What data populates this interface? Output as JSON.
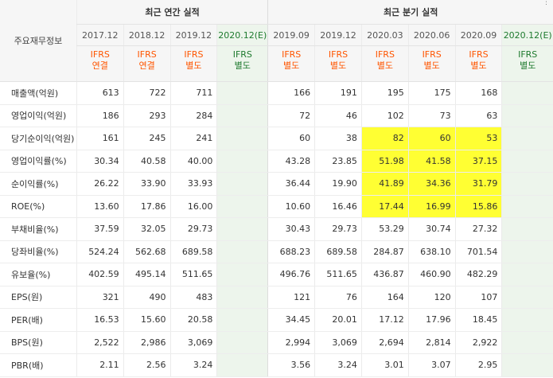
{
  "corner_label": "주요재무정보",
  "groups": {
    "annual": "최근 연간 실적",
    "quarterly": "최근 분기 실적"
  },
  "periods": [
    {
      "year": "2017.12",
      "ifrs": "IFRS",
      "basis": "연결",
      "est": false
    },
    {
      "year": "2018.12",
      "ifrs": "IFRS",
      "basis": "연결",
      "est": false
    },
    {
      "year": "2019.12",
      "ifrs": "IFRS",
      "basis": "별도",
      "est": false
    },
    {
      "year": "2020.12(E)",
      "ifrs": "IFRS",
      "basis": "별도",
      "est": true
    },
    {
      "year": "2019.09",
      "ifrs": "IFRS",
      "basis": "별도",
      "est": false
    },
    {
      "year": "2019.12",
      "ifrs": "IFRS",
      "basis": "별도",
      "est": false
    },
    {
      "year": "2020.03",
      "ifrs": "IFRS",
      "basis": "별도",
      "est": false
    },
    {
      "year": "2020.06",
      "ifrs": "IFRS",
      "basis": "별도",
      "est": false
    },
    {
      "year": "2020.09",
      "ifrs": "IFRS",
      "basis": "별도",
      "est": false
    },
    {
      "year": "2020.12(E)",
      "ifrs": "IFRS",
      "basis": "별도",
      "est": true
    }
  ],
  "rows": [
    {
      "label": "매출액(억원)",
      "values": [
        "613",
        "722",
        "711",
        "",
        "166",
        "191",
        "195",
        "175",
        "168",
        ""
      ],
      "group_start": false
    },
    {
      "label": "영업이익(억원)",
      "values": [
        "186",
        "293",
        "284",
        "",
        "72",
        "46",
        "102",
        "73",
        "63",
        ""
      ],
      "group_start": false
    },
    {
      "label": "당기순이익(억원)",
      "values": [
        "161",
        "245",
        "241",
        "",
        "60",
        "38",
        "82",
        "60",
        "53",
        ""
      ],
      "group_start": false
    },
    {
      "label": "영업이익률(%)",
      "values": [
        "30.34",
        "40.58",
        "40.00",
        "",
        "43.28",
        "23.85",
        "51.98",
        "41.58",
        "37.15",
        ""
      ],
      "group_start": true
    },
    {
      "label": "순이익률(%)",
      "values": [
        "26.22",
        "33.90",
        "33.93",
        "",
        "36.44",
        "19.90",
        "41.89",
        "34.36",
        "31.79",
        ""
      ],
      "group_start": false
    },
    {
      "label": "ROE(%)",
      "values": [
        "13.60",
        "17.86",
        "16.00",
        "",
        "10.60",
        "16.46",
        "17.44",
        "16.99",
        "15.86",
        ""
      ],
      "group_start": false
    },
    {
      "label": "부채비율(%)",
      "values": [
        "37.59",
        "32.05",
        "29.73",
        "",
        "30.43",
        "29.73",
        "53.29",
        "30.74",
        "27.32",
        ""
      ],
      "group_start": true
    },
    {
      "label": "당좌비율(%)",
      "values": [
        "524.24",
        "562.68",
        "689.58",
        "",
        "688.23",
        "689.58",
        "284.87",
        "638.10",
        "701.54",
        ""
      ],
      "group_start": false
    },
    {
      "label": "유보율(%)",
      "values": [
        "402.59",
        "495.14",
        "511.65",
        "",
        "496.76",
        "511.65",
        "436.87",
        "460.90",
        "482.29",
        ""
      ],
      "group_start": false
    },
    {
      "label": "EPS(원)",
      "values": [
        "321",
        "490",
        "483",
        "",
        "121",
        "76",
        "164",
        "120",
        "107",
        ""
      ],
      "group_start": true
    },
    {
      "label": "PER(배)",
      "values": [
        "16.53",
        "15.60",
        "20.58",
        "",
        "34.45",
        "20.01",
        "17.12",
        "17.96",
        "18.45",
        ""
      ],
      "group_start": false
    },
    {
      "label": "BPS(원)",
      "values": [
        "2,522",
        "2,986",
        "3,069",
        "",
        "2,994",
        "3,069",
        "2,694",
        "2,814",
        "2,922",
        ""
      ],
      "group_start": false
    },
    {
      "label": "PBR(배)",
      "values": [
        "2.11",
        "2.56",
        "3.24",
        "",
        "3.56",
        "3.24",
        "3.01",
        "3.07",
        "2.95",
        ""
      ],
      "group_start": false
    }
  ],
  "highlighted_cells": [
    {
      "row": 2,
      "cols": [
        6,
        7,
        8
      ]
    },
    {
      "row": 3,
      "cols": [
        6,
        7,
        8
      ]
    },
    {
      "row": 4,
      "cols": [
        6,
        7,
        8
      ]
    },
    {
      "row": 5,
      "cols": [
        6,
        7,
        8
      ]
    }
  ],
  "highlight_color": "#ffff33",
  "ifrs_color": "#ff5500",
  "estimate_color": "#1e7a2e",
  "estimate_bg": "#edf5ec"
}
